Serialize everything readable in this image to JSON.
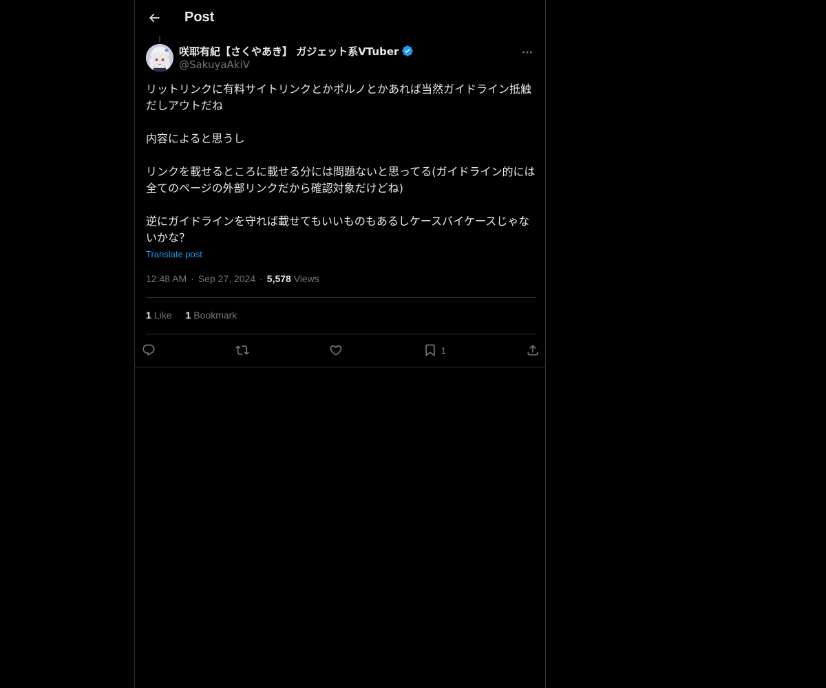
{
  "header": {
    "title": "Post"
  },
  "author": {
    "name": "咲耶有紀【さくやあき】 ガジェット系VTuber",
    "handle": "@SakuyaAkiV",
    "verified": true
  },
  "post": {
    "paragraphs": [
      "リットリンクに有料サイトリンクとかポルノとかあれば当然ガイドライン抵触だしアウトだね",
      "内容によると思うし",
      "リンクを載せるところに載せる分には問題ないと思ってる(ガイドライン的には全てのページの外部リンクだから確認対象だけどね)",
      "逆にガイドラインを守れば載せてもいいものもあるしケースバイケースじゃないかな？"
    ],
    "translate_label": "Translate post",
    "time": "12:48 AM",
    "date": "Sep 27, 2024",
    "views_count": "5,578",
    "views_label": "Views"
  },
  "stats": {
    "likes_count": "1",
    "likes_label": "Like",
    "bookmarks_count": "1",
    "bookmarks_label": "Bookmark"
  },
  "actions": {
    "bookmark_count": "1",
    "icons": [
      "reply-icon",
      "repost-icon",
      "like-icon",
      "bookmark-icon",
      "share-icon"
    ]
  },
  "colors": {
    "background": "#000000",
    "text": "#e7e9ea",
    "muted": "#71767b",
    "accent": "#1d9bf0",
    "border": "#2f3336"
  }
}
